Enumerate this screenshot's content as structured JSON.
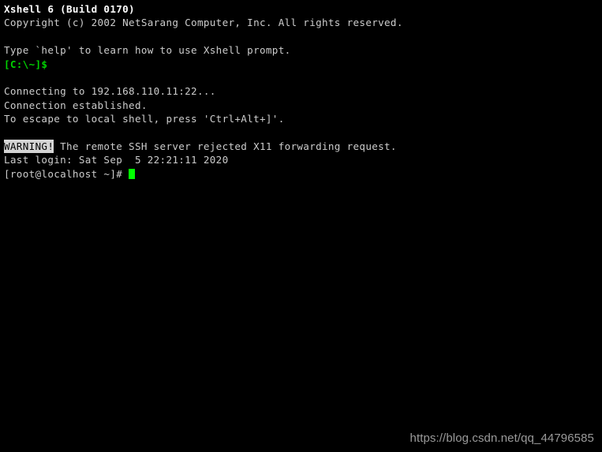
{
  "terminal": {
    "background_color": "#000000",
    "default_text_color": "#c8c8c8",
    "prompt_color": "#00d200",
    "cursor_color": "#00ff00",
    "inverse_bg_color": "#d4d4d4",
    "lines": {
      "banner_title": "Xshell 6 (Build 0170)",
      "copyright": "Copyright (c) 2002 NetSarang Computer, Inc. All rights reserved.",
      "help_hint": "Type `help' to learn how to use Xshell prompt.",
      "local_prompt": "[C:\\~]$",
      "connecting": "Connecting to 192.168.110.11:22...",
      "connection_established": "Connection established.",
      "escape_hint": "To escape to local shell, press 'Ctrl+Alt+]'.",
      "warning_badge": "WARNING!",
      "warning_message": " The remote SSH server rejected X11 forwarding request.",
      "last_login": "Last login: Sat Sep  5 22:21:11 2020",
      "remote_prompt": "[root@localhost ~]# "
    }
  },
  "watermark": {
    "text": "https://blog.csdn.net/qq_44796585"
  }
}
